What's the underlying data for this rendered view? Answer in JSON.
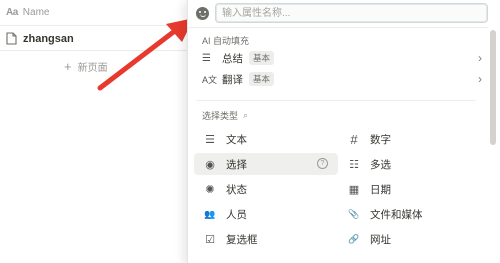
{
  "table": {
    "column_prefix": "Aa",
    "column_name": "Name",
    "rows": [
      {
        "title": "zhangsan"
      }
    ],
    "new_page_label": "新页面"
  },
  "popup": {
    "search": {
      "placeholder": "输入属性名称..."
    },
    "ai_section": {
      "label": "AI 自动填充",
      "items": [
        {
          "icon": "summary-icon",
          "label": "总结",
          "tag": "基本"
        },
        {
          "icon": "translate-icon",
          "label": "翻译",
          "tag": "基本"
        }
      ]
    },
    "type_section": {
      "label": "选择类型",
      "items": [
        {
          "icon": "text-icon",
          "glyph": "☰",
          "label": "文本"
        },
        {
          "icon": "number-icon",
          "glyph": "#",
          "label": "数字"
        },
        {
          "icon": "select-icon",
          "glyph": "◉",
          "label": "选择",
          "active": true
        },
        {
          "icon": "multi-select-icon",
          "glyph": "☷",
          "label": "多选"
        },
        {
          "icon": "status-icon",
          "glyph": "✺",
          "label": "状态"
        },
        {
          "icon": "date-icon",
          "glyph": "▦",
          "label": "日期"
        },
        {
          "icon": "person-icon",
          "glyph": "👥",
          "label": "人员"
        },
        {
          "icon": "files-media-icon",
          "glyph": "📎",
          "label": "文件和媒体"
        },
        {
          "icon": "checkbox-icon",
          "glyph": "☑",
          "label": "复选框"
        },
        {
          "icon": "url-icon",
          "glyph": "🔗",
          "label": "网址"
        }
      ]
    }
  },
  "colors": {
    "arrow": "#e8392e",
    "active_row": "#efefed"
  }
}
